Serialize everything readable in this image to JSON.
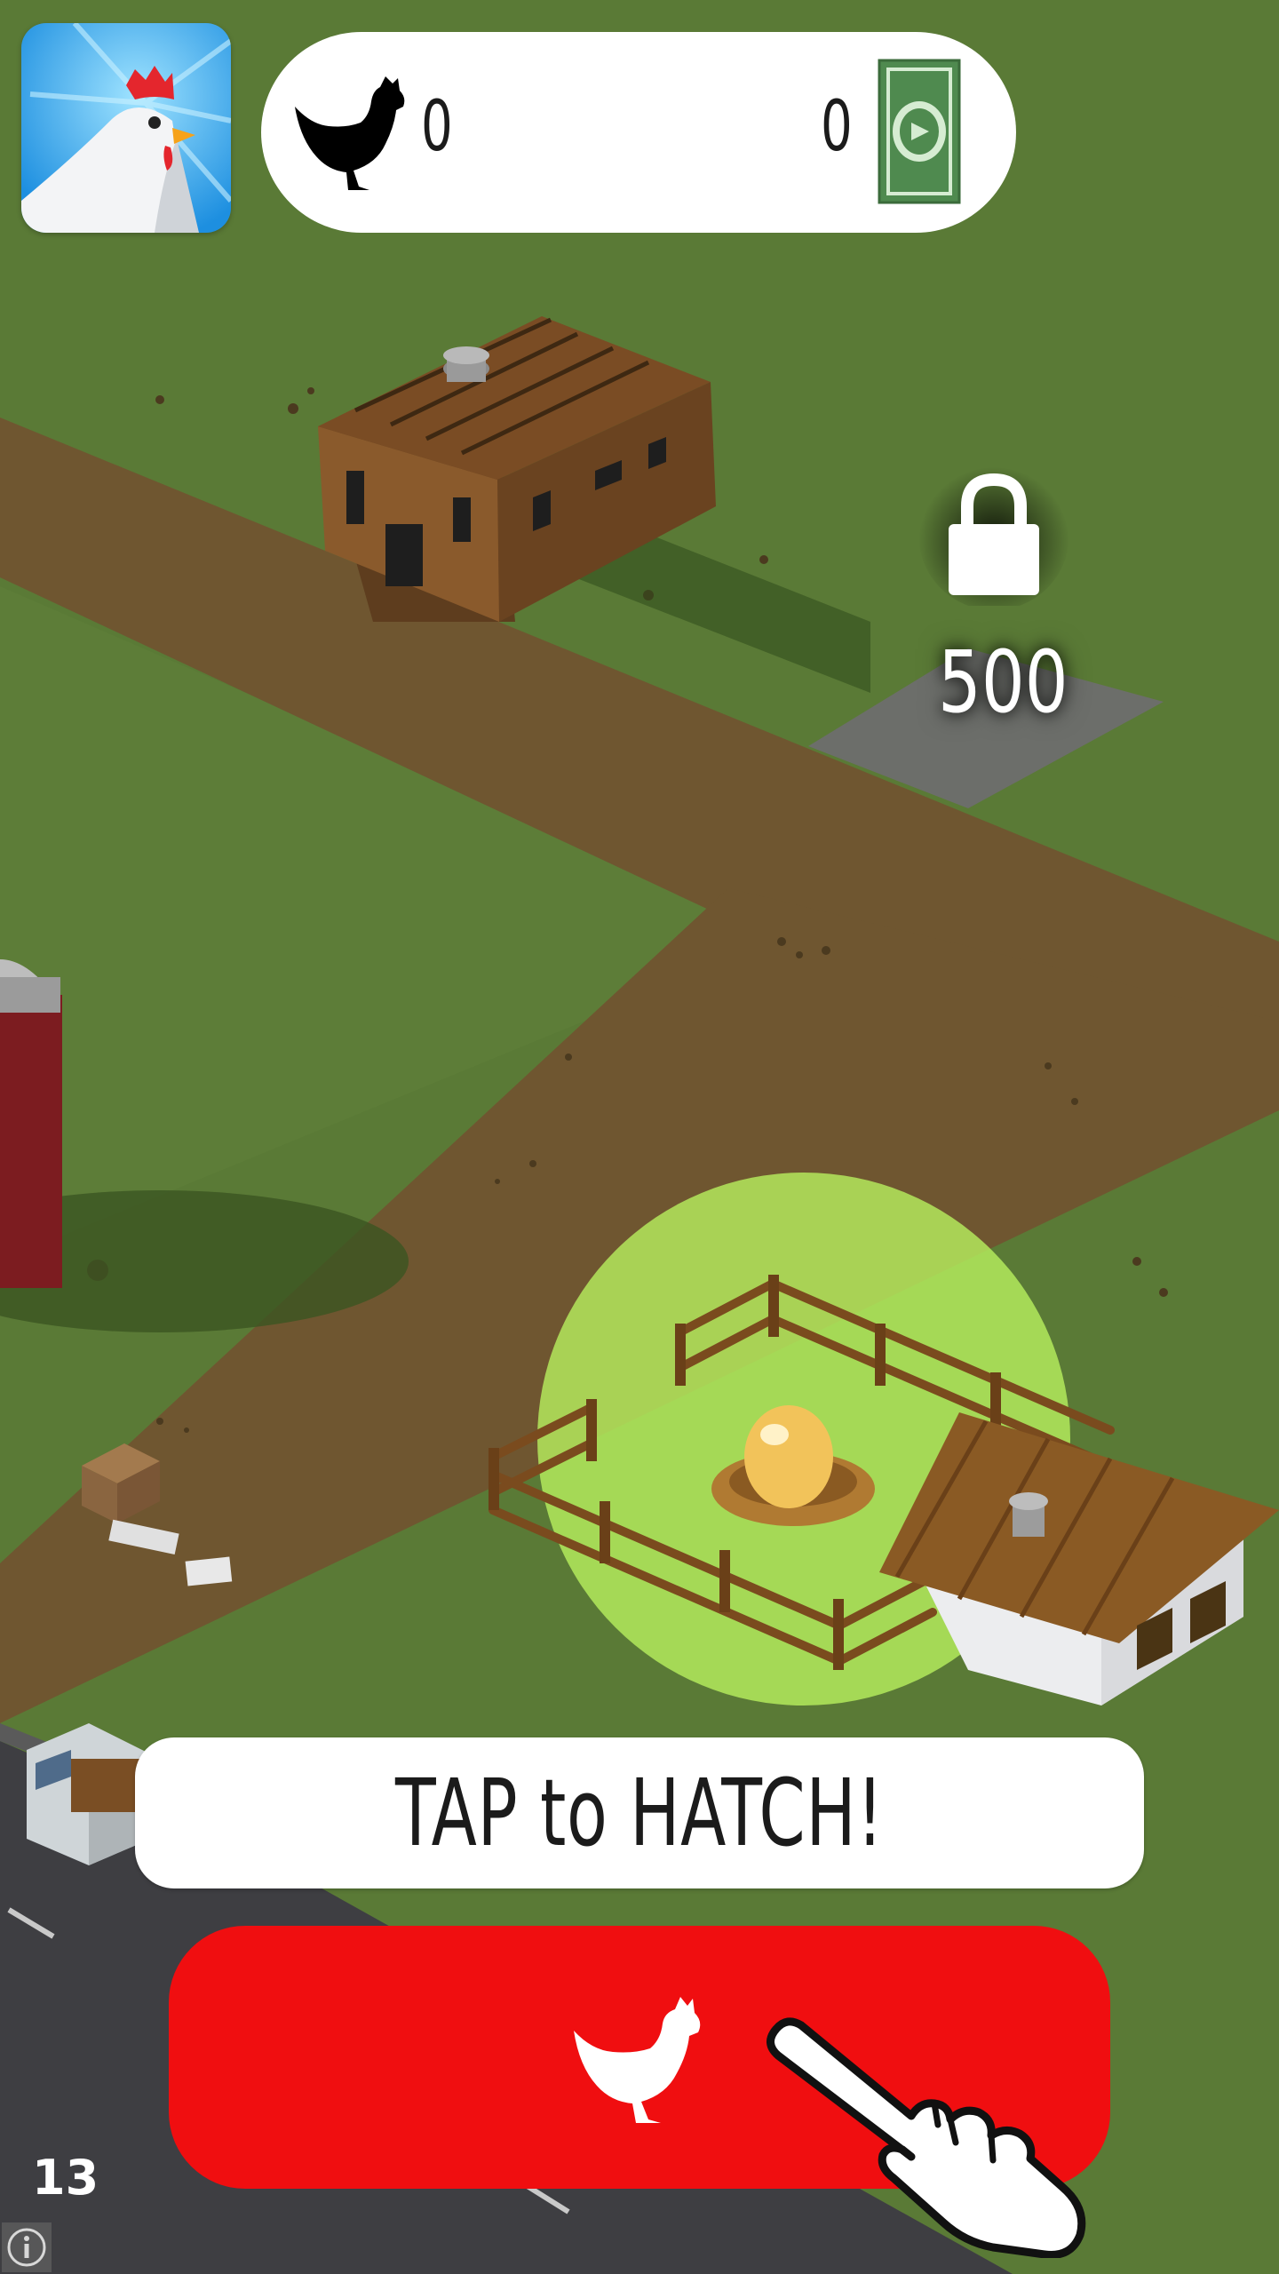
{
  "hud": {
    "chicken_count": "0",
    "money_count": "0"
  },
  "locked_plot": {
    "price": "500"
  },
  "banner": {
    "text": "TAP to HATCH!"
  },
  "debug": {
    "fps": "13"
  },
  "colors": {
    "grass": "#5a7a36",
    "road": "#6f5630",
    "hatch_button": "#f00e10",
    "highlight": "#b6ee5e",
    "cash_green": "#4f8a4f"
  },
  "icons": [
    "app-icon",
    "chicken-silhouette-icon",
    "cash-icon",
    "lock-icon",
    "chicken-button-icon",
    "pointing-hand-icon",
    "info-icon"
  ]
}
